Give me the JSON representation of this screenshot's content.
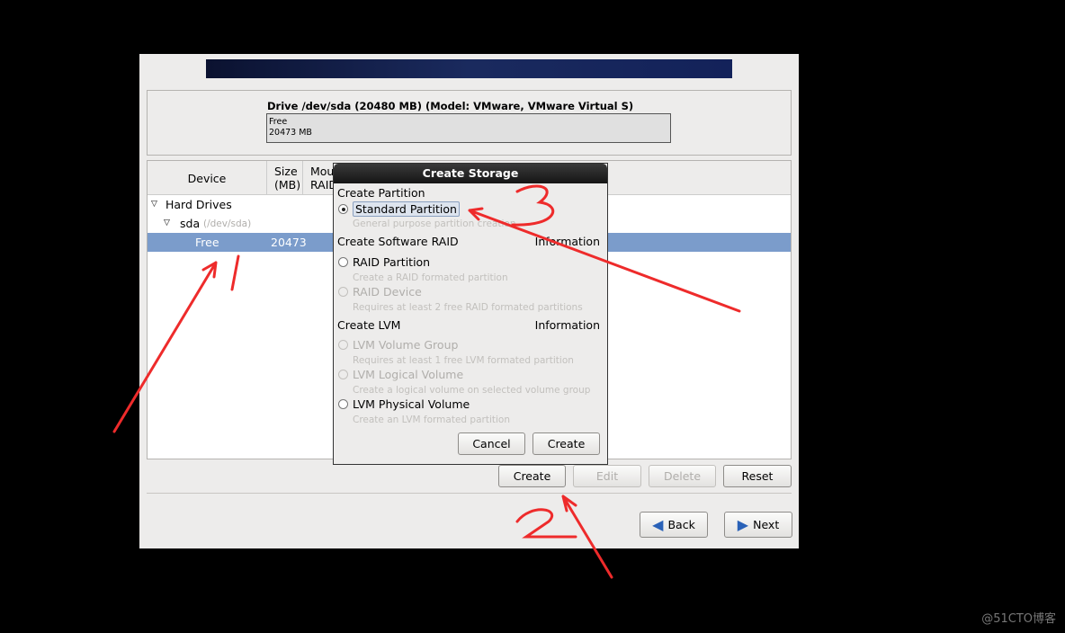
{
  "drive": {
    "title": "Drive /dev/sda (20480 MB) (Model: VMware, VMware Virtual S)",
    "bar_label": "Free",
    "bar_size": "20473 MB"
  },
  "table": {
    "headers": [
      "Device",
      "Size\n(MB)",
      "Mou\nRAID"
    ],
    "rows": [
      {
        "device": "Hard Drives"
      },
      {
        "device": "sda",
        "path": "(/dev/sda)"
      },
      {
        "device": "Free",
        "size": "20473"
      }
    ]
  },
  "buttons": {
    "create": "Create",
    "edit": "Edit",
    "delete": "Delete",
    "reset": "Reset",
    "back": "Back",
    "next": "Next"
  },
  "dialog": {
    "title": "Create Storage",
    "partition_section": "Create Partition",
    "standard": "Standard Partition",
    "standard_desc": "General purpose partition creation",
    "raid_section": "Create Software RAID",
    "info": "Information",
    "raid_partition": "RAID Partition",
    "raid_partition_desc": "Create a RAID formated partition",
    "raid_device": "RAID Device",
    "raid_device_desc": "Requires at least 2 free RAID formated partitions",
    "lvm_section": "Create LVM",
    "lvm_vg": "LVM Volume Group",
    "lvm_vg_desc": "Requires at least 1 free LVM formated partition",
    "lvm_lv": "LVM Logical Volume",
    "lvm_lv_desc": "Create a logical volume on selected volume group",
    "lvm_pv": "LVM Physical Volume",
    "lvm_pv_desc": "Create an LVM formated partition",
    "cancel": "Cancel",
    "create": "Create"
  },
  "watermark": "@51CTO博客",
  "annotation_color": "#ee2b2b"
}
